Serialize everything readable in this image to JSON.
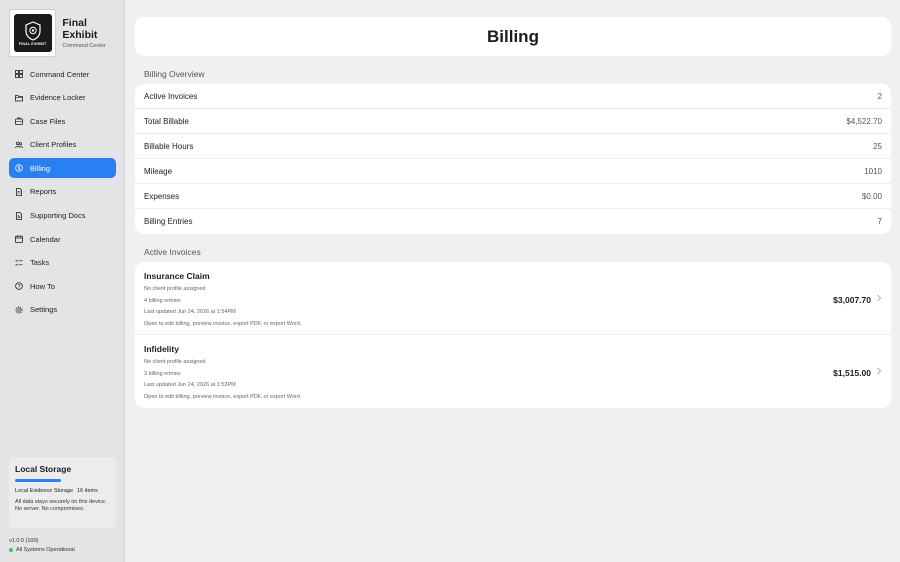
{
  "app": {
    "title": "Final Exhibit",
    "subtitle": "Command Center",
    "logo_text": "FINAL EXHIBIT"
  },
  "sidebar": {
    "items": [
      {
        "label": "Command Center",
        "icon": "grid-icon"
      },
      {
        "label": "Evidence Locker",
        "icon": "folder-icon"
      },
      {
        "label": "Case Files",
        "icon": "briefcase-icon"
      },
      {
        "label": "Client Profiles",
        "icon": "people-icon"
      },
      {
        "label": "Billing",
        "icon": "dollar-circle-icon",
        "active": true
      },
      {
        "label": "Reports",
        "icon": "document-icon"
      },
      {
        "label": "Supporting Docs",
        "icon": "doc-attachment-icon"
      },
      {
        "label": "Calendar",
        "icon": "calendar-icon"
      },
      {
        "label": "Tasks",
        "icon": "checklist-icon"
      },
      {
        "label": "How To",
        "icon": "help-circle-icon"
      },
      {
        "label": "Settings",
        "icon": "gear-icon"
      }
    ],
    "storage": {
      "title": "Local Storage",
      "label": "Local Evidence Storage",
      "count": "16 items",
      "note": "All data stays securely on this device. No server. No compromises."
    },
    "version": "v1.0.0 (100)",
    "status": "All Systems Operational"
  },
  "page": {
    "title": "Billing"
  },
  "overview": {
    "section_label": "Billing Overview",
    "rows": [
      {
        "label": "Active Invoices",
        "value": "2"
      },
      {
        "label": "Total Billable",
        "value": "$4,522.70"
      },
      {
        "label": "Billable Hours",
        "value": "25"
      },
      {
        "label": "Mileage",
        "value": "1010"
      },
      {
        "label": "Expenses",
        "value": "$0.00"
      },
      {
        "label": "Billing Entries",
        "value": "7"
      }
    ]
  },
  "invoices": {
    "section_label": "Active Invoices",
    "items": [
      {
        "title": "Insurance Claim",
        "client": "No client profile assigned",
        "entries": "4 billing entries",
        "updated": "Last updated Jun 24, 2026 at 1:54PM",
        "hint": "Open to edit billing, preview invoice, export PDF, or export Word.",
        "amount": "$3,007.70"
      },
      {
        "title": "Infidelity",
        "client": "No client profile assigned",
        "entries": "3 billing entries",
        "updated": "Last updated Jun 24, 2026 at 1:53PM",
        "hint": "Open to edit billing, preview invoice, export PDF, or export Word.",
        "amount": "$1,515.00"
      }
    ]
  },
  "colors": {
    "accent": "#2a80f2",
    "status_ok": "#34c759",
    "sidebar_bg": "#e4e4e6",
    "page_bg": "#f0f0f2"
  }
}
